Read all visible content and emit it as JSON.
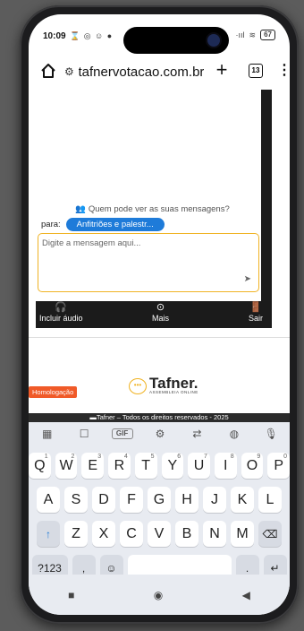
{
  "status_bar": {
    "time": "10:09",
    "left_icons": "⌛ ◎ ☺ ●",
    "signal_label": "·ııl",
    "wifi_label": "≋",
    "battery_level": "67"
  },
  "browser": {
    "url": "tafnervotacao.com.br/",
    "tab_count": "13"
  },
  "chat": {
    "visibility_text": "Quem pode ver as suas mensagens?",
    "to_label": "para:",
    "recipient": "Anfitriões e palestr...",
    "message_placeholder": "Digite a mensagem aqui..."
  },
  "controls": {
    "audio_label": "Incluir áudio",
    "more_label": "Mais",
    "exit_label": "Sair"
  },
  "footer": {
    "env_badge": "Homologação",
    "logo_name": "Tafner.",
    "logo_sub": "ASSEMBLEIA ONLINE",
    "copyright": "Tafner – Todos os direitos reservados - 2025"
  },
  "keyboard": {
    "toolbar_gif": "GIF",
    "row1": [
      {
        "k": "Q",
        "h": "1"
      },
      {
        "k": "W",
        "h": "2"
      },
      {
        "k": "E",
        "h": "3"
      },
      {
        "k": "R",
        "h": "4"
      },
      {
        "k": "T",
        "h": "5"
      },
      {
        "k": "Y",
        "h": "6"
      },
      {
        "k": "U",
        "h": "7"
      },
      {
        "k": "I",
        "h": "8"
      },
      {
        "k": "O",
        "h": "9"
      },
      {
        "k": "P",
        "h": "0"
      }
    ],
    "row2": [
      "A",
      "S",
      "D",
      "F",
      "G",
      "H",
      "J",
      "K",
      "L"
    ],
    "row3": [
      "Z",
      "X",
      "C",
      "V",
      "B",
      "N",
      "M"
    ],
    "numbers_key": "?123",
    "comma_key": ",",
    "period_key": "."
  },
  "colors": {
    "accent_blue": "#1e7bd9",
    "highlight_yellow": "#f0b323",
    "badge_orange": "#f05a28"
  }
}
